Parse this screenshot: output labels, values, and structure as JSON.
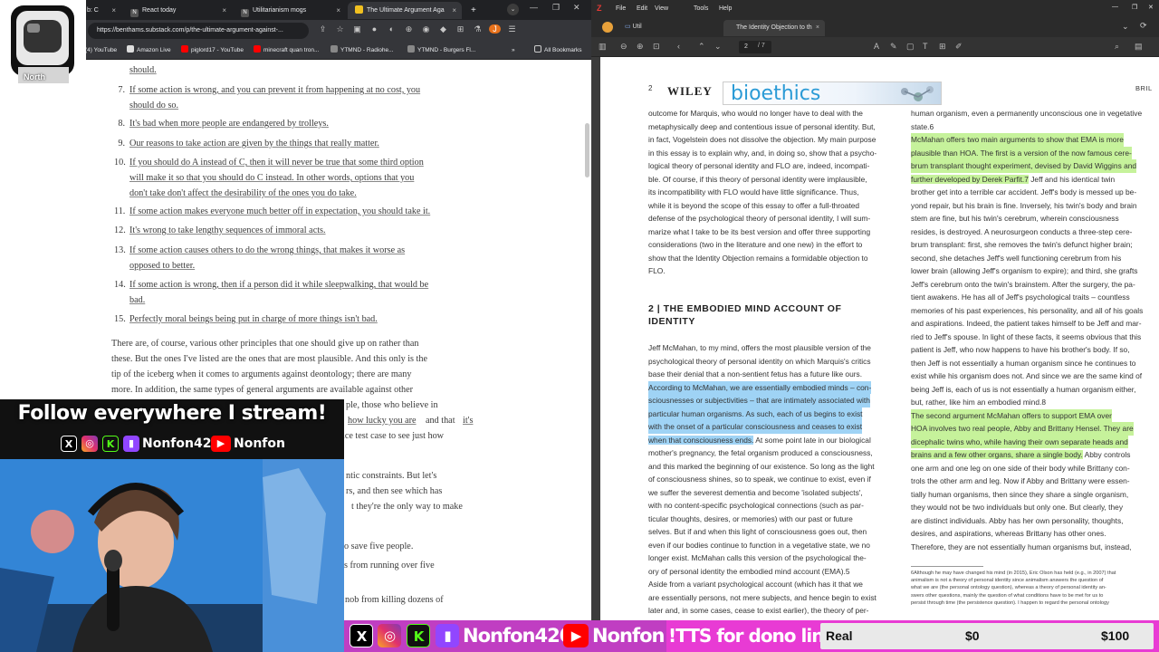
{
  "browser": {
    "tabs": [
      {
        "label": "b: C",
        "close": "×"
      },
      {
        "label": "React today",
        "close": "×"
      },
      {
        "label": "Utilitarianism mogs",
        "close": "×"
      },
      {
        "label": "The Ultimate Argument Aga",
        "close": "×"
      }
    ],
    "new_tab": "+",
    "url": "https://benthams.substack.com/p/the-ultimate-argument-against-...",
    "bookmarks": [
      "(4) YouTube",
      "Amazon Live",
      "piglord17 - YouTube",
      "minecraft quan tron...",
      "YTMND - Radiohe...",
      "YTMND - Burgers Fl...",
      "»",
      "All Bookmarks"
    ]
  },
  "article": {
    "top_fragment": "should.",
    "list": [
      {
        "num": "7.",
        "lines": [
          "If some action is wrong, and you can prevent it from happening at no cost, you",
          "should do so."
        ]
      },
      {
        "num": "8.",
        "lines": [
          "It's bad when more people are endangered by trolleys."
        ]
      },
      {
        "num": "9.",
        "lines": [
          "Our reasons to take action are given by the things that really matter."
        ]
      },
      {
        "num": "10.",
        "lines": [
          "If you should do A instead of C, then it will never be true that some third option",
          "will make it so that you should do C instead. In other words, options that you",
          "don't take don't affect the desirability of the ones you do take."
        ]
      },
      {
        "num": "11.",
        "lines": [
          "If some action makes everyone much better off in expectation, you should take it."
        ]
      },
      {
        "num": "12.",
        "lines": [
          "It's wrong to take lengthy sequences of immoral acts."
        ]
      },
      {
        "num": "13.",
        "lines": [
          "If some action causes others to do the wrong things, that makes it worse as",
          "opposed to better."
        ]
      },
      {
        "num": "14.",
        "lines": [
          "If some action is wrong, then if a person did it while sleepwalking, that would be",
          "bad."
        ]
      },
      {
        "num": "15.",
        "lines": [
          "Perfectly moral beings being put in charge of more things isn't bad."
        ]
      }
    ],
    "paragraph": [
      "There are, of course, various other principles that one should give up on rather than",
      "these. But the ones I've listed are the ones that are most plausible. And this only is the",
      "tip of the iceberg when it comes to arguments against deontology; there are many",
      "more. In addition, the same types of general arguments are available against other"
    ],
    "fragments": [
      "ple, those who believe in",
      "how lucky you are",
      "and that",
      "it's",
      "ice test case to see just how",
      "ntic constraints. But let's",
      "rs, and then see which has",
      "t they're the only way to make",
      "o save five people.",
      "s from running over five",
      "nob from killing dozens of"
    ]
  },
  "overlay": {
    "avatar_label": "North",
    "follow_title": "Follow everywhere I stream!",
    "handle": "Nonfon420",
    "youtube_name": "Nonfon",
    "tts": "!TTS for dono link",
    "goal": {
      "label": "Real",
      "current": "$0",
      "target": "$100"
    }
  },
  "pdf": {
    "menu": [
      "File",
      "Edit",
      "View",
      "Tools",
      "Help"
    ],
    "folder_tab": "Util",
    "doc_tab": "The Identity Objection to th",
    "doc_tab_close": "×",
    "page_indicator": "2",
    "page_total": "/ 7",
    "page_num": "2",
    "publisher": "WILEY",
    "journal": "bioethics",
    "running_head": "BRIL",
    "left_col": [
      "outcome for Marquis, who would no longer have to deal with the",
      "metaphysically deep and contentious issue of personal identity. But,",
      "in fact, Vogelstein does not dissolve the objection. My main purpose",
      "in this essay is to explain why, and, in doing so, show that a psycho-",
      "logical theory of personal identity and FLO are, indeed, incompati-",
      "ble. Of course, if this theory of personal identity were implausible,",
      "its incompatibility with FLO would have little significance. Thus,",
      "while it is beyond the scope of this essay to offer a full-throated",
      "defense of the psychological theory of personal identity, I will sum-",
      "marize what I take to be its best version and offer three supporting",
      "considerations (two in the literature and one new) in the effort to",
      "show that the Identity Objection remains a formidable objection to",
      "FLO."
    ],
    "section_title_1": "2  |  THE EMBODIED MIND ACCOUNT OF",
    "section_title_2": "IDENTITY",
    "left_col2": [
      "Jeff McMahan, to my mind, offers the most plausible version of the",
      "psychological theory of personal identity on which Marquis's critics",
      "base their denial that a non-sentient fetus has a future like ours."
    ],
    "left_hl": [
      "According to McMahan, we are essentially embodied minds – con-",
      "sciousnesses or subjectivities – that are intimately associated with",
      "particular human organisms. As such, each of us begins to exist",
      "with the onset of a particular consciousness and ceases to exist",
      "when that consciousness ends."
    ],
    "left_hl_tail": " At some point late in our biological",
    "left_col3": [
      "mother's pregnancy, the fetal organism produced a consciousness,",
      "and this marked the beginning of our existence. So long as the light",
      "of consciousness shines, so to speak, we continue to exist, even if",
      "we suffer the severest dementia and become 'isolated subjects',",
      "with no content-specific psychological connections (such as par-",
      "ticular thoughts, desires, or memories) with our past or future",
      "selves. But if and when this light of consciousness goes out, then",
      "even if our bodies continue to function in a vegetative state, we no",
      "longer exist. McMahan calls this version of the psychological the-",
      "ory of personal identity the embodied mind account (EMA).5",
      "",
      "    Aside from a variant psychological account (which has it that we",
      "are essentially persons, not mere subjects, and hence begin to exist",
      "later and, in some cases, cease to exist earlier), the theory of per-"
    ],
    "right_col": [
      "human organism, even a permanently unconscious one in vegetative",
      "state.6"
    ],
    "right_hl": [
      "    McMahan offers two main arguments to show that EMA is more",
      "plausible than HOA. The first is a version of the now famous cere-",
      "brum transplant thought experiment, devised by David Wiggins and",
      "further developed by Derek Parfit.7"
    ],
    "right_col2": [
      "brother get into a terrible car accident. Jeff's body is messed up be-",
      "yond repair, but his brain is fine. Inversely, his twin's body and brain",
      "stem are fine, but his twin's cerebrum, wherein consciousness",
      "resides, is destroyed. A neurosurgeon conducts a three-step cere-",
      "brum transplant: first, she removes the twin's defunct higher brain;",
      "second, she detaches Jeff's well functioning cerebrum from his",
      "lower brain (allowing Jeff's organism to expire); and third, she grafts",
      "Jeff's cerebrum onto the twin's brainstem. After the surgery, the pa-",
      "tient awakens. He has all of Jeff's psychological traits – countless",
      "memories of his past experiences, his personality, and all of his goals",
      "and aspirations. Indeed, the patient takes himself to be Jeff and mar-",
      "ried to Jeff's spouse. In light of these facts, it seems obvious that this",
      "patient is Jeff, who now happens to have his brother's body. If so,",
      "then Jeff is not essentially a human organism since he continues to",
      "exist while his organism does not. And since we are the same kind of",
      "being Jeff is, each of us is not essentially a human organism either,",
      "but, rather, like him an embodied mind.8"
    ],
    "right_hl2": [
      "    The second argument McMahan offers to support EMA over",
      "HOA involves two real people, Abby and Brittany Hensel. They are",
      "dicephalic twins who, while having their own separate heads and",
      "brains and a few other organs, share a single body."
    ],
    "jeff_tail": " Jeff and his identical twin",
    "abby_tail": " Abby controls",
    "right_col3": [
      "one arm and one leg on one side of their body while Brittany con-",
      "trols the other arm and leg. Now if Abby and Brittany were essen-",
      "tially human organisms, then since they share a single organism,",
      "they would not be two individuals but only one. But clearly, they",
      "are distinct individuals. Abby has her own personality, thoughts,",
      "desires, and aspirations, whereas Brittany has other ones.",
      "Therefore, they are not essentially human organisms but, instead,"
    ],
    "footnotes": [
      "6Although he may have changed his mind (in 2015), Eric Olson has held (e.g., in 2007) that",
      "animalism is not a theory of personal identity since animalism answers the question of",
      "what we are (the personal ontology question), whereas a theory of personal identity an-",
      "swers other questions, mainly the question of what conditions have to be met for us to",
      "persist through time (the persistence question). I happen to regard the personal ontology"
    ]
  }
}
